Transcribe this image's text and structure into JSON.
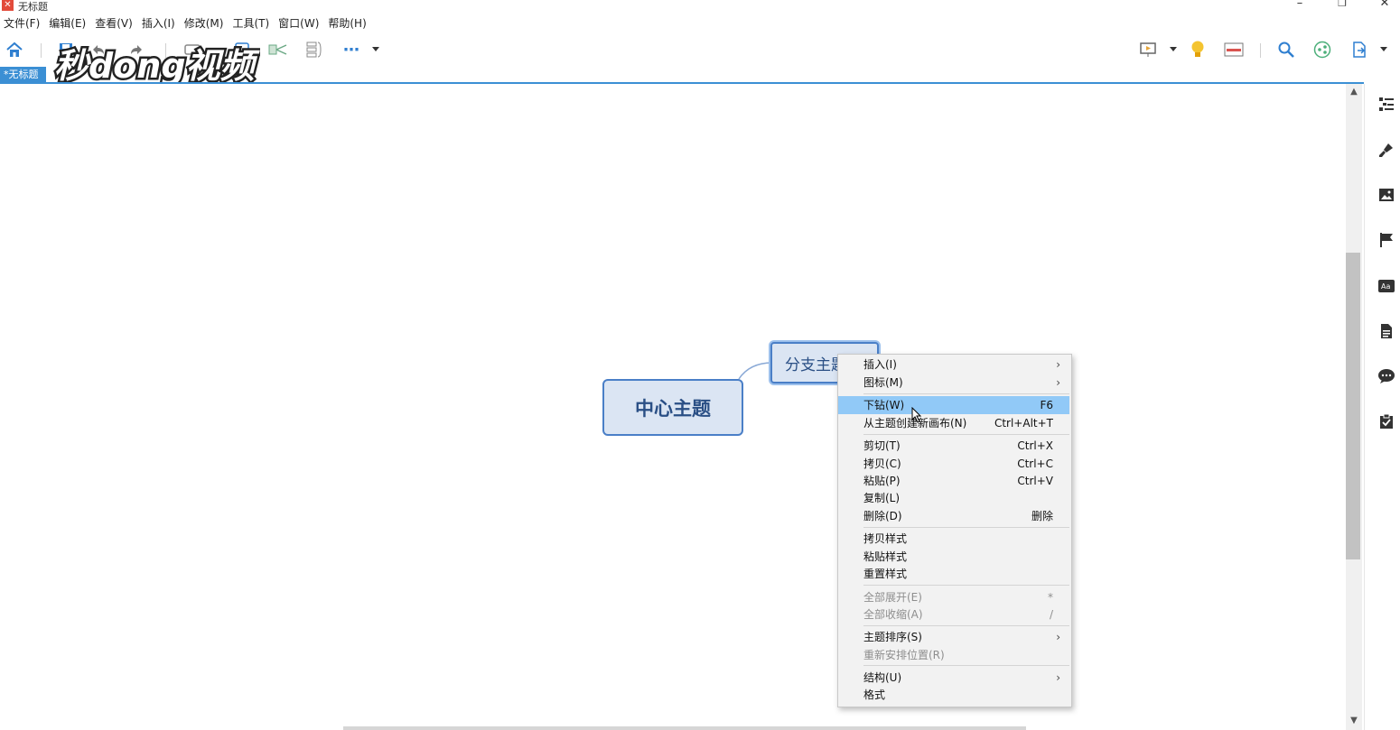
{
  "window": {
    "title": "无标题",
    "minimize": "–",
    "restore": "❐",
    "close": "✕"
  },
  "menubar": [
    "文件(F)",
    "编辑(E)",
    "查看(V)",
    "插入(I)",
    "修改(M)",
    "工具(T)",
    "窗口(W)",
    "帮助(H)"
  ],
  "watermark": "秒dong视频",
  "tab": {
    "label": "*无标题"
  },
  "canvas": {
    "central_topic": "中心主题",
    "branch_topic": "分支主题"
  },
  "context_menu": {
    "items": [
      {
        "label": "插入(I)",
        "shortcut": "",
        "submenu": true,
        "disabled": false
      },
      {
        "label": "图标(M)",
        "shortcut": "",
        "submenu": true,
        "disabled": false
      },
      {
        "label": "下钻(W)",
        "shortcut": "F6",
        "submenu": false,
        "disabled": false,
        "highlighted": true
      },
      {
        "label": "从主题创建新画布(N)",
        "shortcut": "Ctrl+Alt+T",
        "submenu": false,
        "disabled": false
      },
      {
        "label": "剪切(T)",
        "shortcut": "Ctrl+X",
        "submenu": false,
        "disabled": false
      },
      {
        "label": "拷贝(C)",
        "shortcut": "Ctrl+C",
        "submenu": false,
        "disabled": false
      },
      {
        "label": "粘贴(P)",
        "shortcut": "Ctrl+V",
        "submenu": false,
        "disabled": false
      },
      {
        "label": "复制(L)",
        "shortcut": "",
        "submenu": false,
        "disabled": false
      },
      {
        "label": "删除(D)",
        "shortcut": "删除",
        "submenu": false,
        "disabled": false
      },
      {
        "label": "拷贝样式",
        "shortcut": "",
        "submenu": false,
        "disabled": false
      },
      {
        "label": "粘贴样式",
        "shortcut": "",
        "submenu": false,
        "disabled": false
      },
      {
        "label": "重置样式",
        "shortcut": "",
        "submenu": false,
        "disabled": false
      },
      {
        "label": "全部展开(E)",
        "shortcut": "*",
        "submenu": false,
        "disabled": true
      },
      {
        "label": "全部收缩(A)",
        "shortcut": "/",
        "submenu": false,
        "disabled": true
      },
      {
        "label": "主题排序(S)",
        "shortcut": "",
        "submenu": true,
        "disabled": false
      },
      {
        "label": "重新安排位置(R)",
        "shortcut": "",
        "submenu": false,
        "disabled": true
      },
      {
        "label": "结构(U)",
        "shortcut": "",
        "submenu": true,
        "disabled": false
      },
      {
        "label": "格式",
        "shortcut": "",
        "submenu": false,
        "disabled": false
      }
    ]
  },
  "icons": {
    "home": "home-icon",
    "more": "⋯",
    "scroll_up": "▲",
    "scroll_down": "▼",
    "submenu_arrow": "›"
  },
  "colors": {
    "accent": "#3b8fd4",
    "topic_fill": "#dbe5f3",
    "topic_border": "#4a7fc7",
    "topic_text": "#2a4f85",
    "menu_highlight": "#91c9f7"
  }
}
